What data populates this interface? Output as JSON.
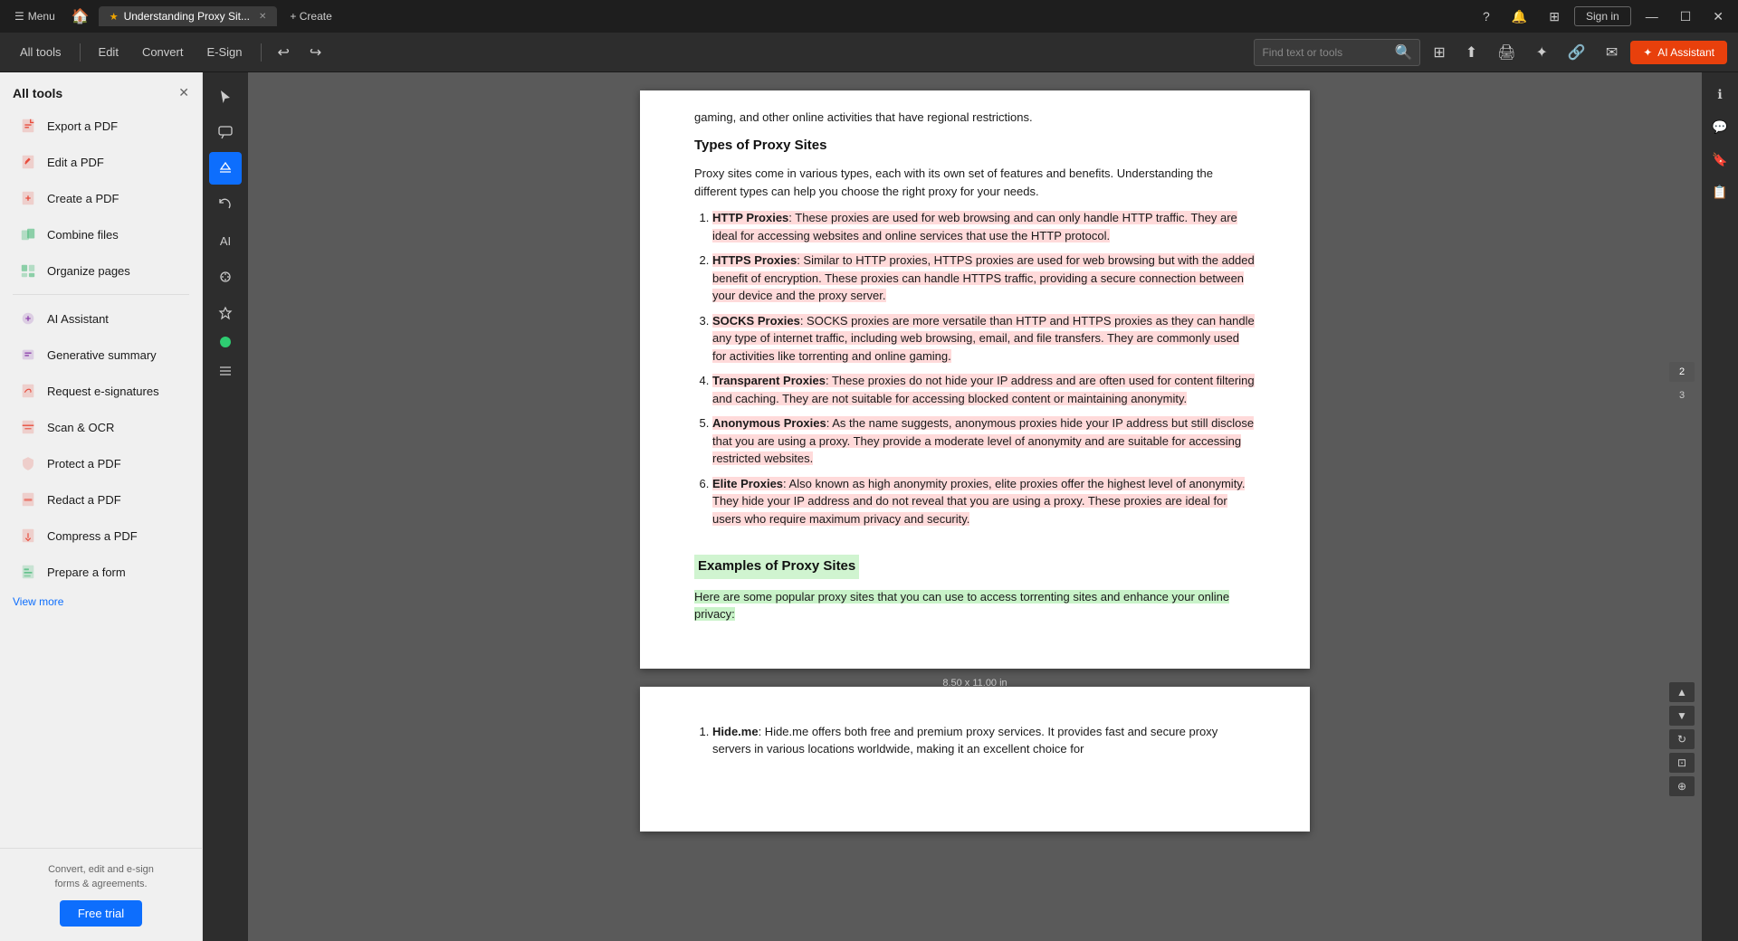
{
  "titlebar": {
    "menu": "Menu",
    "tab_title": "Understanding Proxy Sit...",
    "new_tab": "+ Create",
    "sign_in": "Sign in",
    "window_controls": [
      "—",
      "☐",
      "✕"
    ]
  },
  "toolbar": {
    "all_tools": "All tools",
    "edit": "Edit",
    "convert": "Convert",
    "e_sign": "E-Sign",
    "find_placeholder": "Find text or tools",
    "ai_assistant": "AI Assistant"
  },
  "sidebar": {
    "title": "All tools",
    "items": [
      {
        "id": "export-pdf",
        "label": "Export a PDF",
        "color": "#e74c3c"
      },
      {
        "id": "edit-pdf",
        "label": "Edit a PDF",
        "color": "#e74c3c"
      },
      {
        "id": "create-pdf",
        "label": "Create a PDF",
        "color": "#e74c3c"
      },
      {
        "id": "combine-files",
        "label": "Combine files",
        "color": "#27ae60"
      },
      {
        "id": "organize-pages",
        "label": "Organize pages",
        "color": "#27ae60"
      },
      {
        "id": "ai-assistant",
        "label": "AI Assistant",
        "color": "#8e44ad"
      },
      {
        "id": "generative-summary",
        "label": "Generative summary",
        "color": "#8e44ad"
      },
      {
        "id": "request-e-signatures",
        "label": "Request e-signatures",
        "color": "#e74c3c"
      },
      {
        "id": "scan-ocr",
        "label": "Scan & OCR",
        "color": "#e74c3c"
      },
      {
        "id": "protect-pdf",
        "label": "Protect a PDF",
        "color": "#e74c3c"
      },
      {
        "id": "redact-pdf",
        "label": "Redact a PDF",
        "color": "#e74c3c"
      },
      {
        "id": "compress-pdf",
        "label": "Compress a PDF",
        "color": "#e74c3c"
      },
      {
        "id": "prepare-form",
        "label": "Prepare a form",
        "color": "#27ae60"
      }
    ],
    "view_more": "View more",
    "footer_text": "Convert, edit and e-sign\nforms & agreements.",
    "free_trial": "Free trial"
  },
  "pdf": {
    "page_size": "8.50 x 11.00 in",
    "content": {
      "intro_text": "gaming, and other online activities that have regional restrictions.",
      "section1_heading": "Types of Proxy Sites",
      "section1_intro": "Proxy sites come in various types, each with its own set of features and benefits. Understanding the different types can help you choose the right proxy for your needs.",
      "list_items": [
        {
          "num": "1.",
          "bold": "HTTP Proxies",
          "text": ": These proxies are used for web browsing and can only handle HTTP traffic. They are ideal for accessing websites and online services that use the HTTP protocol."
        },
        {
          "num": "2.",
          "bold": "HTTPS Proxies",
          "text": ": Similar to HTTP proxies, HTTPS proxies are used for web browsing but with the added benefit of encryption. These proxies can handle HTTPS traffic, providing a secure connection between your device and the proxy server."
        },
        {
          "num": "3.",
          "bold": "SOCKS Proxies",
          "text": ": SOCKS proxies are more versatile than HTTP and HTTPS proxies as they can handle any type of internet traffic, including web browsing, email, and file transfers. They are commonly used for activities like torrenting and online gaming."
        },
        {
          "num": "4.",
          "bold": "Transparent Proxies",
          "text": ": These proxies do not hide your IP address and are often used for content filtering and caching. They are not suitable for accessing blocked content or maintaining anonymity."
        },
        {
          "num": "5.",
          "bold": "Anonymous Proxies",
          "text": ": As the name suggests, anonymous proxies hide your IP address but still disclose that you are using a proxy. They provide a moderate level of anonymity and are suitable for accessing restricted websites."
        },
        {
          "num": "6.",
          "bold": "Elite Proxies",
          "text": ": Also known as high anonymity proxies, elite proxies offer the highest level of anonymity. They hide your IP address and do not reveal that you are using a proxy. These proxies are ideal for users who require maximum privacy and security."
        }
      ],
      "section2_heading": "Examples of Proxy Sites",
      "section2_intro": "Here are some popular proxy sites that you can use to access torrenting sites and enhance your online privacy:",
      "page2_item": {
        "bold": "Hide.me",
        "text": ": Hide.me offers both free and premium proxy services. It provides fast and secure proxy servers in various locations worldwide, making it an excellent choice for"
      }
    },
    "page_numbers": [
      "2",
      "3"
    ],
    "current_page": "2"
  }
}
